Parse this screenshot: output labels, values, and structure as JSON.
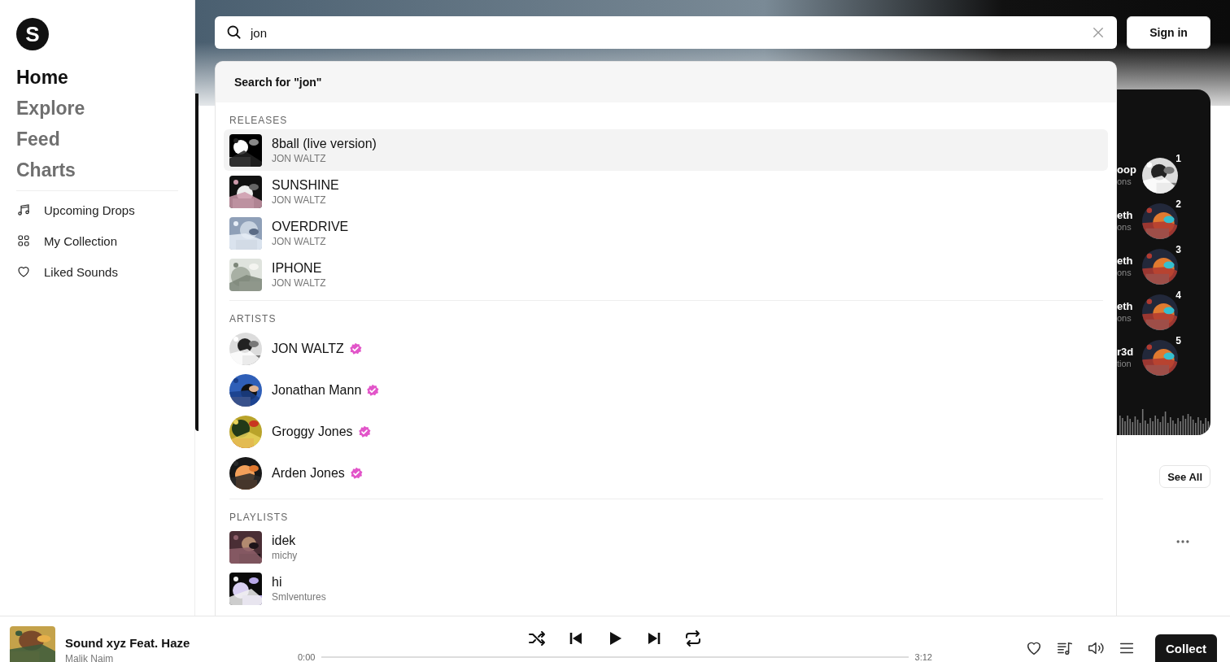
{
  "sidebar": {
    "logo": "S",
    "nav": [
      {
        "label": "Home",
        "selected": true
      },
      {
        "label": "Explore",
        "selected": false
      },
      {
        "label": "Feed",
        "selected": false
      },
      {
        "label": "Charts",
        "selected": false
      }
    ],
    "links": [
      {
        "label": "Upcoming Drops",
        "kind": "music"
      },
      {
        "label": "My Collection",
        "kind": "grid"
      },
      {
        "label": "Liked Sounds",
        "kind": "heart"
      }
    ]
  },
  "search": {
    "value": "jon"
  },
  "sign_in": "Sign in",
  "dropdown": {
    "search_for": "Search for \"jon\"",
    "sections": [
      {
        "title": "RELEASES",
        "kind": "release",
        "items": [
          {
            "title": "8ball (live version)",
            "subtitle": "JON WALTZ",
            "selected": true
          },
          {
            "title": "SUNSHINE",
            "subtitle": "JON WALTZ",
            "selected": false
          },
          {
            "title": "OVERDRIVE",
            "subtitle": "JON WALTZ",
            "selected": false
          },
          {
            "title": "IPHONE",
            "subtitle": "JON WALTZ",
            "selected": false
          }
        ]
      },
      {
        "title": "ARTISTS",
        "kind": "artist",
        "items": [
          {
            "title": "JON WALTZ",
            "verified": true,
            "selected": false
          },
          {
            "title": "Jonathan Mann",
            "verified": true,
            "selected": false
          },
          {
            "title": "Groggy Jones",
            "verified": true,
            "selected": false
          },
          {
            "title": "Arden Jones",
            "verified": true,
            "selected": false
          }
        ]
      },
      {
        "title": "PLAYLISTS",
        "kind": "playlist",
        "items": [
          {
            "title": "idek",
            "subtitle": "michy",
            "selected": false
          },
          {
            "title": "hi",
            "subtitle": "Smlventures",
            "selected": false
          }
        ]
      }
    ]
  },
  "chart_card": {
    "items": [
      {
        "title": "oop",
        "subtitle": "ons",
        "rank": "1"
      },
      {
        "title": "eth",
        "subtitle": "ons",
        "rank": "2"
      },
      {
        "title": "eth",
        "subtitle": "ons",
        "rank": "3"
      },
      {
        "title": "eth",
        "subtitle": "ons",
        "rank": "4"
      },
      {
        "title": "r3d",
        "subtitle": "tion",
        "rank": "5"
      }
    ]
  },
  "see_all": "See All",
  "player": {
    "title": "Sound xyz Feat. Haze",
    "artist": "Malik Naim",
    "elapsed": "0:00",
    "duration": "3:12",
    "collect": "Collect"
  }
}
